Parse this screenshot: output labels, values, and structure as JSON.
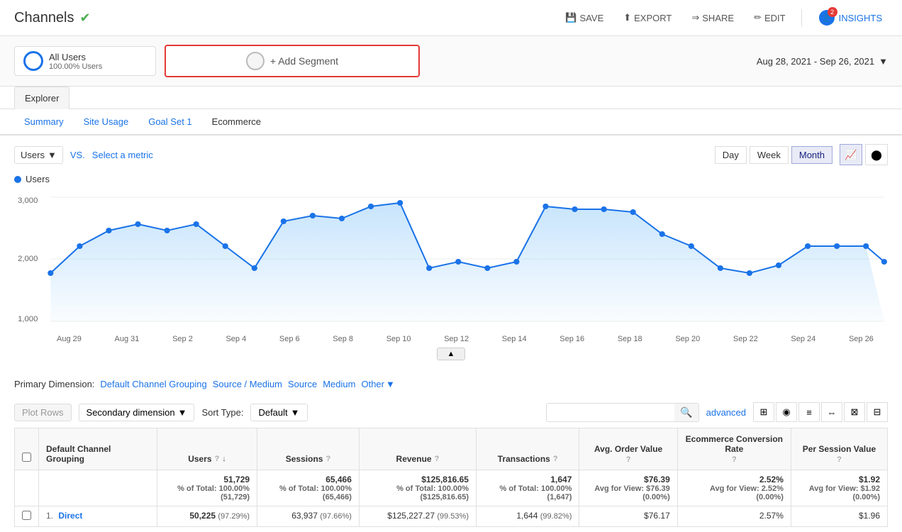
{
  "header": {
    "title": "Channels",
    "verified": true,
    "actions": {
      "save": "SAVE",
      "export": "EXPORT",
      "share": "SHARE",
      "edit": "EDIT",
      "insights": "INSIGHTS",
      "insights_badge": "2"
    }
  },
  "segment": {
    "name": "All Users",
    "percentage": "100.00% Users",
    "add_label": "+ Add Segment"
  },
  "date_range": "Aug 28, 2021 - Sep 26, 2021",
  "tabs": {
    "explorer": "Explorer",
    "sub": [
      {
        "label": "Summary",
        "active": false,
        "blue": true
      },
      {
        "label": "Site Usage",
        "active": false,
        "blue": true
      },
      {
        "label": "Goal Set 1",
        "active": false,
        "blue": true
      },
      {
        "label": "Ecommerce",
        "active": false,
        "plain": true
      }
    ]
  },
  "chart_controls": {
    "metric": "Users",
    "vs_label": "VS.",
    "select_metric": "Select a metric",
    "time_buttons": [
      "Day",
      "Week",
      "Month"
    ],
    "active_time": "Month"
  },
  "chart": {
    "legend": "Users",
    "y_labels": [
      "3,000",
      "2,000",
      "1,000"
    ],
    "x_labels": [
      "Aug 29",
      "Aug 31",
      "Sep 2",
      "Sep 4",
      "Sep 6",
      "Sep 8",
      "Sep 10",
      "Sep 12",
      "Sep 14",
      "Sep 16",
      "Sep 18",
      "Sep 20",
      "Sep 22",
      "Sep 24",
      "Sep 26"
    ],
    "data_points": [
      1650,
      2050,
      2350,
      2450,
      2350,
      2450,
      2050,
      1700,
      2500,
      2700,
      2650,
      2850,
      2900,
      1700,
      1600,
      1700,
      1800,
      2900,
      2850,
      2850,
      2800,
      2400,
      2200,
      1600,
      1650,
      1750,
      2000
    ]
  },
  "dimension": {
    "primary_label": "Primary Dimension:",
    "default_label": "Default Channel Grouping",
    "source_medium": "Source / Medium",
    "source": "Source",
    "medium": "Medium",
    "other": "Other"
  },
  "table_controls": {
    "plot_rows": "Plot Rows",
    "secondary_dim": "Secondary dimension",
    "sort_type_label": "Sort Type:",
    "sort_default": "Default",
    "search_placeholder": "",
    "advanced": "advanced"
  },
  "table": {
    "headers": [
      {
        "label": "Default Channel Grouping",
        "align": "left"
      },
      {
        "label": "Users",
        "has_info": true,
        "has_sort": true
      },
      {
        "label": "Sessions",
        "has_info": true
      },
      {
        "label": "Revenue",
        "has_info": true
      },
      {
        "label": "Transactions",
        "has_info": true
      },
      {
        "label": "Avg. Order Value",
        "has_info": true
      },
      {
        "label": "Ecommerce Conversion Rate",
        "has_info": true
      },
      {
        "label": "Per Session Value",
        "has_info": true
      }
    ],
    "totals": {
      "users": "51,729",
      "users_sub": "% of Total: 100.00% (51,729)",
      "sessions": "65,466",
      "sessions_sub": "% of Total: 100.00% (65,466)",
      "revenue": "$125,816.65",
      "revenue_sub": "% of Total: 100.00% ($125,816.65)",
      "transactions": "1,647",
      "transactions_sub": "% of Total: 100.00% (1,647)",
      "avg_order": "$76.39",
      "avg_order_sub": "Avg for View: $76.39 (0.00%)",
      "conversion": "2.52%",
      "conversion_sub": "Avg for View: 2.52% (0.00%)",
      "per_session": "$1.92",
      "per_session_sub": "Avg for View: $1.92 (0.00%)"
    },
    "rows": [
      {
        "num": "1.",
        "name": "Direct",
        "users": "50,225",
        "users_pct": "(97.29%)",
        "sessions": "63,937",
        "sessions_pct": "(97.66%)",
        "revenue": "$125,227.27",
        "revenue_pct": "(99.53%)",
        "transactions": "1,644",
        "transactions_pct": "(99.82%)",
        "avg_order": "$76.17",
        "conversion": "2.57%",
        "per_session": "$1.96"
      }
    ]
  }
}
